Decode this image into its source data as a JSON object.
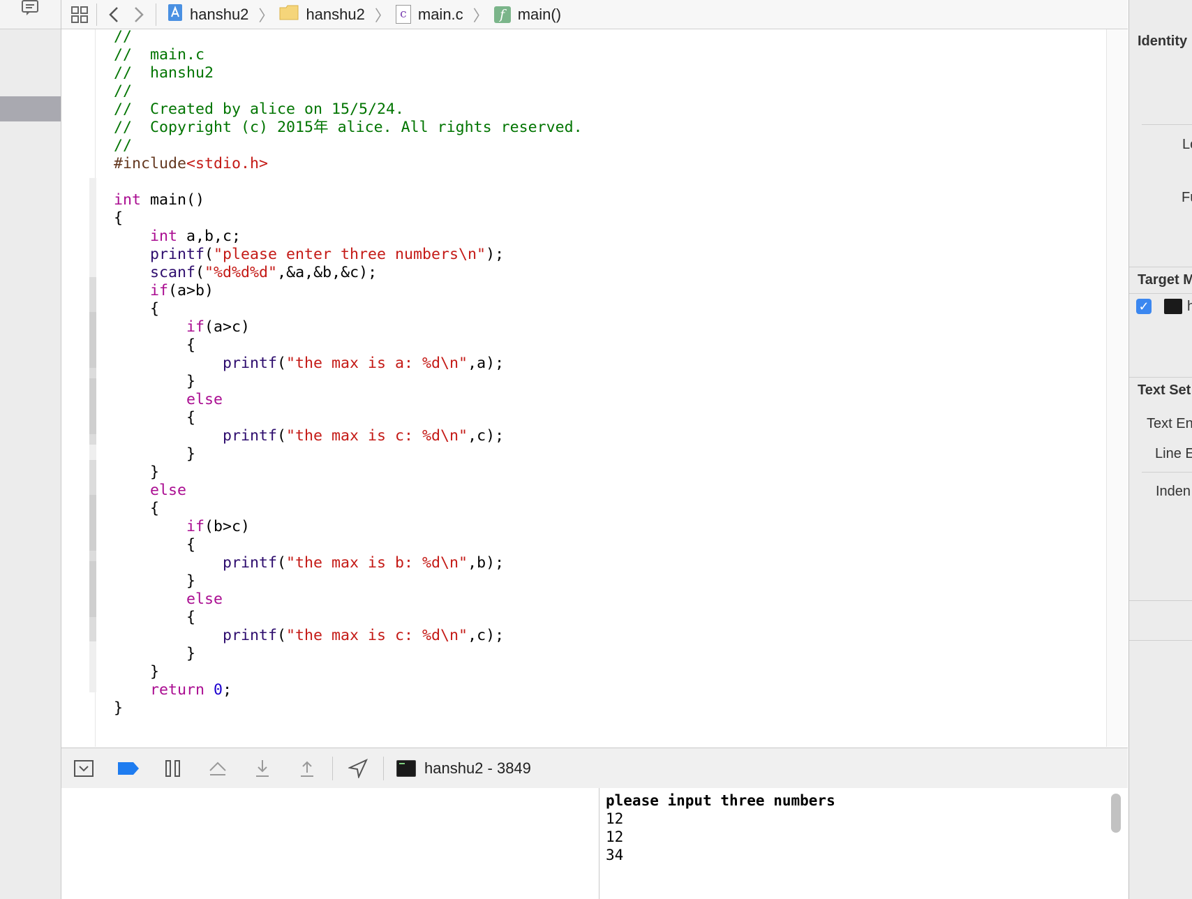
{
  "jump_bar": {
    "items": [
      {
        "label": "hanshu2",
        "icon": "xcode-project-icon"
      },
      {
        "label": "hanshu2",
        "icon": "folder-icon"
      },
      {
        "label": "main.c",
        "icon": "c-file-icon"
      },
      {
        "label": "main()",
        "icon": "function-icon"
      }
    ],
    "c_file_glyph": "c",
    "function_glyph": "f"
  },
  "code_lines": [
    "//",
    "//  main.c",
    "//  hanshu2",
    "//",
    "//  Created by alice on 15/5/24.",
    "//  Copyright (c) 2015年 alice. All rights reserved.",
    "//",
    "#include<stdio.h>",
    "",
    "int main()",
    "{",
    "    int a,b,c;",
    "    printf(\"please enter three numbers\\n\");",
    "    scanf(\"%d%d%d\",&a,&b,&c);",
    "    if(a>b)",
    "    {",
    "        if(a>c)",
    "        {",
    "            printf(\"the max is a: %d\\n\",a);",
    "        }",
    "        else",
    "        {",
    "            printf(\"the max is c: %d\\n\",c);",
    "        }",
    "    }",
    "    else",
    "    {",
    "        if(b>c)",
    "        {",
    "            printf(\"the max is b: %d\\n\",b);",
    "        }",
    "        else",
    "        {",
    "            printf(\"the max is c: %d\\n\",c);",
    "        }",
    "    }",
    "    return 0;",
    "}"
  ],
  "debug_bar": {
    "process_label": "hanshu2 - 3849"
  },
  "console": {
    "lines": [
      {
        "text": "please input three numbers",
        "bold": true
      },
      {
        "text": "12",
        "bold": false
      },
      {
        "text": "12",
        "bold": false
      },
      {
        "text": "34",
        "bold": false
      }
    ]
  },
  "inspector": {
    "identity_header": "Identity",
    "location_label": "Lo",
    "fullpath_label": "Fu",
    "target_header": "Target M",
    "target_item": "h",
    "text_settings_header": "Text Set",
    "text_encoding_label": "Text En",
    "line_endings_label": "Line E",
    "indent_label": "Inden"
  },
  "colors": {
    "comment": "#007400",
    "keyword": "#aa0d91",
    "string": "#c41a16",
    "preprocessor": "#643820",
    "function": "#2e0d6e",
    "number": "#1c00cf",
    "breakpoint_blue": "#1e7cf0"
  }
}
